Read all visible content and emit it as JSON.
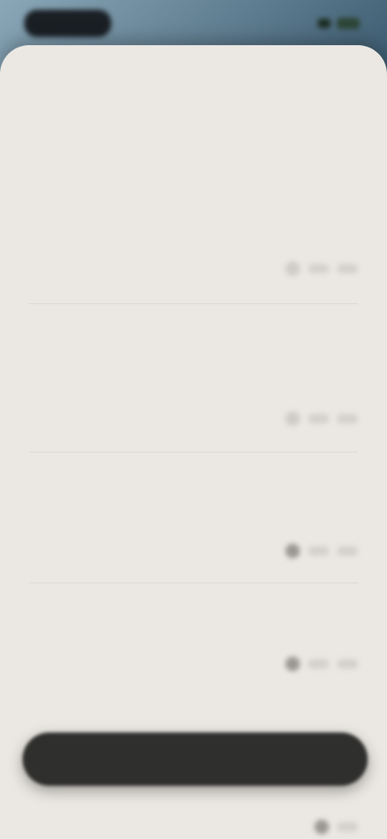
{
  "status_bar": {
    "time": "",
    "icons": [
      "signal-icon",
      "battery-icon"
    ]
  },
  "sheet": {
    "title": ""
  },
  "items": [
    {
      "text": "",
      "meta": "",
      "right": ""
    },
    {
      "text": "",
      "meta": "",
      "right": ""
    },
    {
      "text": "",
      "meta": "",
      "right": ""
    },
    {
      "text": "",
      "meta": "",
      "right": ""
    }
  ],
  "action_bar": {
    "label": ""
  },
  "colors": {
    "sheet_bg": "#ebe8e3",
    "action_bar_bg": "#2f2f2d",
    "wallpaper_dark": "#0d2233"
  }
}
